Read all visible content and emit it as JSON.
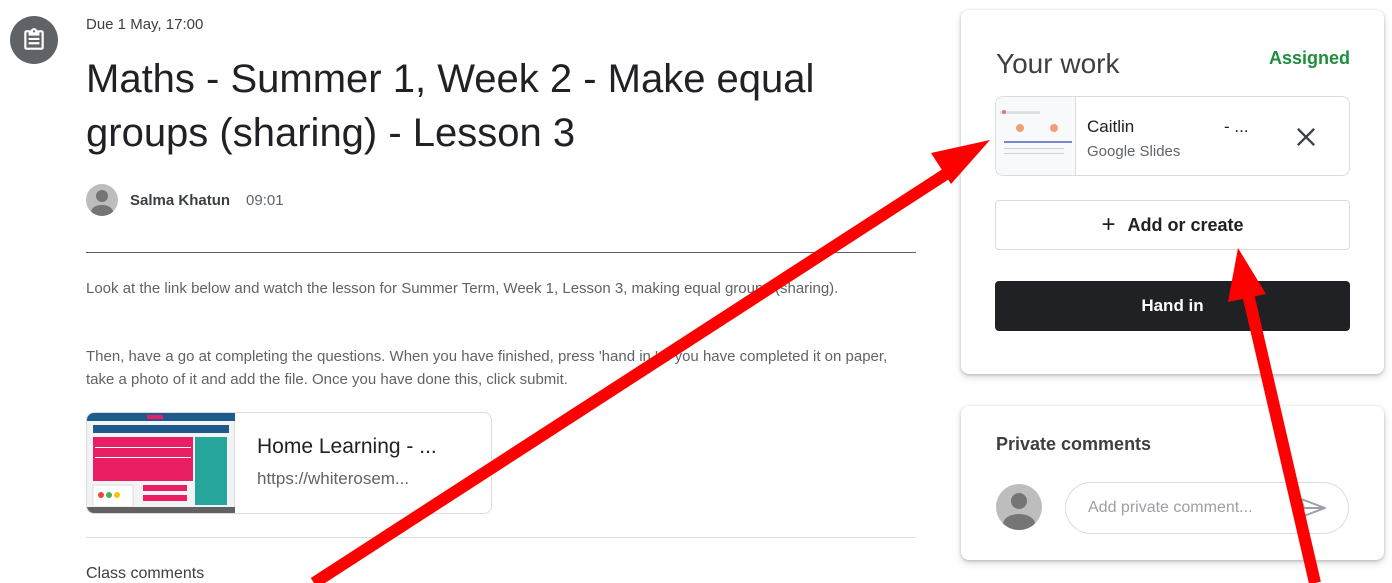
{
  "assignment": {
    "due": "Due 1 May, 17:00",
    "title": "Maths - Summer 1, Week 2 - Make equal groups (sharing) - Lesson 3",
    "author": "Salma Khatun",
    "time": "09:01",
    "description_1": "Look at the link below and watch the lesson for Summer Term, Week 1, Lesson 3, making equal groups (sharing).",
    "description_2": "Then, have a go at completing the questions. When you have finished, press 'hand in.' If you have completed it on paper, take a photo of it and add the file. Once you have done this, click submit.",
    "link_title": "Home Learning - ...",
    "link_url": "https://whiterosem...",
    "class_comments": "Class comments"
  },
  "your_work": {
    "title": "Your work",
    "status": "Assigned",
    "attachment_name": "Caitlin",
    "attachment_trail": "- ...",
    "attachment_type": "Google Slides",
    "add_label": "Add or create",
    "hand_in_label": "Hand in"
  },
  "private_comments": {
    "title": "Private comments",
    "placeholder": "Add private comment..."
  },
  "icons": {
    "assignment": "clipboard-icon",
    "close": "close-icon",
    "add": "plus-icon",
    "send": "send-icon"
  },
  "colors": {
    "status_green": "#1e8e3e",
    "hand_in_bg": "#202124",
    "annotation_arrow": "#ff0000"
  }
}
